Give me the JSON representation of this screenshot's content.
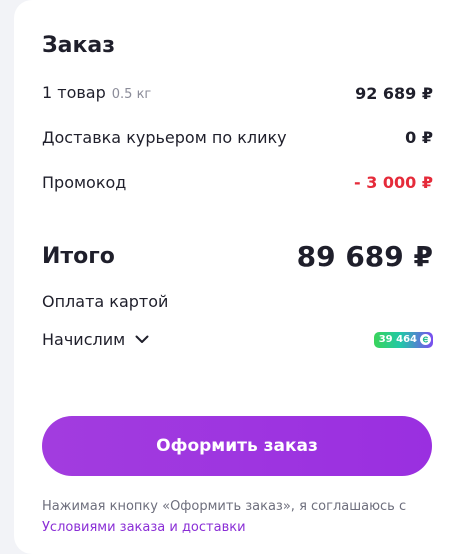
{
  "order": {
    "title": "Заказ",
    "items": {
      "label": "1 товар",
      "weight": "0.5 кг",
      "value": "92 689 ₽"
    },
    "delivery": {
      "label": "Доставка курьером по клику",
      "value": "0 ₽"
    },
    "promo": {
      "label": "Промокод",
      "value": "- 3 000 ₽"
    },
    "total": {
      "label": "Итого",
      "value": "89 689 ₽"
    },
    "payment_method": "Оплата картой",
    "bonus": {
      "label": "Начислим",
      "amount": "39 464"
    },
    "submit_label": "Оформить заказ",
    "legal_text": "Нажимая кнопку «Оформить заказ», я соглашаюсь с",
    "legal_link": "Условиями заказа и доставки"
  },
  "colors": {
    "accent": "#9c2fe0",
    "discount": "#e52b3a",
    "link": "#8a2ed6"
  }
}
